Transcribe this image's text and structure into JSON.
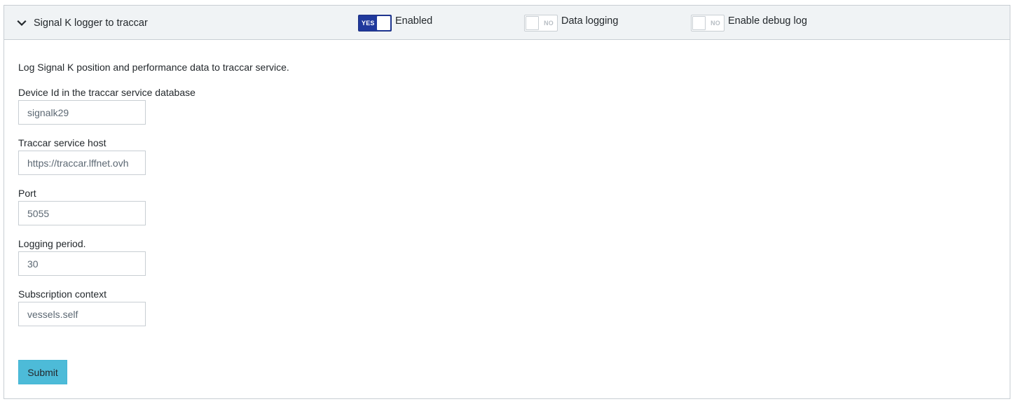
{
  "header": {
    "title": "Signal K logger to traccar",
    "switches": {
      "enabled": {
        "label": "Enabled",
        "state_text": "YES",
        "on": true
      },
      "data_logging": {
        "label": "Data logging",
        "state_text": "NO",
        "on": false
      },
      "debug_log": {
        "label": "Enable debug log",
        "state_text": "NO",
        "on": false
      }
    }
  },
  "body": {
    "description": "Log Signal K position and performance data to traccar service.",
    "fields": [
      {
        "label": "Device Id in the traccar service database",
        "value": "signalk29"
      },
      {
        "label": "Traccar service host",
        "value": "https://traccar.lffnet.ovh"
      },
      {
        "label": "Port",
        "value": "5055"
      },
      {
        "label": "Logging period.",
        "value": "30"
      },
      {
        "label": "Subscription context",
        "value": "vessels.self"
      }
    ],
    "submit_label": "Submit"
  },
  "colors": {
    "switch_on": "#20399c",
    "submit_button": "#4dbbd8",
    "header_background": "#f0f3f5"
  }
}
